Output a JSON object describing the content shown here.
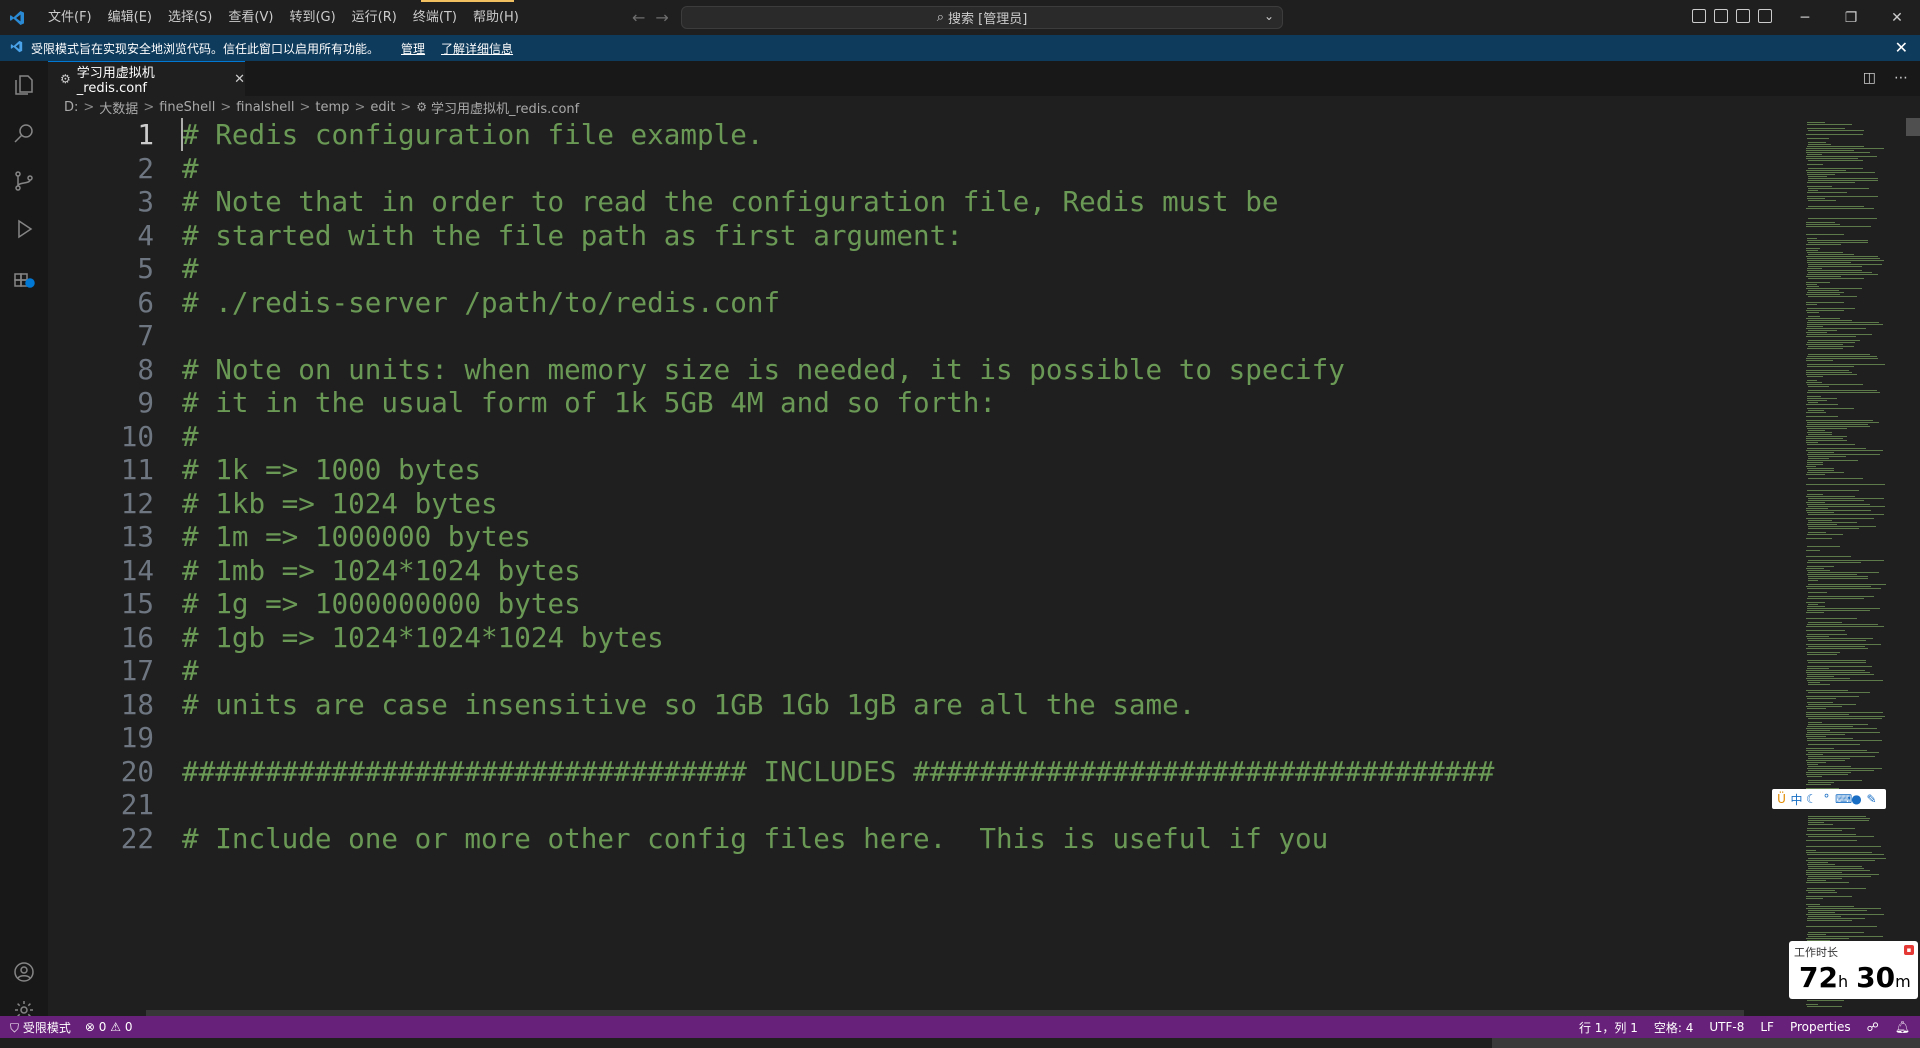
{
  "titlebar": {
    "menu": [
      "文件(F)",
      "编辑(E)",
      "选择(S)",
      "查看(V)",
      "转到(G)",
      "运行(R)",
      "终端(T)",
      "帮助(H)"
    ],
    "search_text": "搜索 [管理员]"
  },
  "banner": {
    "message": "受限模式旨在实现安全地浏览代码。信任此窗口以启用所有功能。",
    "manage_link": "管理",
    "learn_more_link": "了解详细信息"
  },
  "tab": {
    "filename": "学习用虚拟机_redis.conf"
  },
  "breadcrumb": [
    "D:",
    "大数据",
    "fineShell",
    "finalshell",
    "temp",
    "edit",
    "学习用虚拟机_redis.conf"
  ],
  "editor": {
    "active_line": 1,
    "lines": [
      {
        "num": "1",
        "text": "# Redis configuration file example."
      },
      {
        "num": "2",
        "text": "#"
      },
      {
        "num": "3",
        "text": "# Note that in order to read the configuration file, Redis must be"
      },
      {
        "num": "4",
        "text": "# started with the file path as first argument:"
      },
      {
        "num": "5",
        "text": "#"
      },
      {
        "num": "6",
        "text": "# ./redis-server /path/to/redis.conf"
      },
      {
        "num": "7",
        "text": ""
      },
      {
        "num": "8",
        "text": "# Note on units: when memory size is needed, it is possible to specify"
      },
      {
        "num": "9",
        "text": "# it in the usual form of 1k 5GB 4M and so forth:"
      },
      {
        "num": "10",
        "text": "#"
      },
      {
        "num": "11",
        "text": "# 1k => 1000 bytes"
      },
      {
        "num": "12",
        "text": "# 1kb => 1024 bytes"
      },
      {
        "num": "13",
        "text": "# 1m => 1000000 bytes"
      },
      {
        "num": "14",
        "text": "# 1mb => 1024*1024 bytes"
      },
      {
        "num": "15",
        "text": "# 1g => 1000000000 bytes"
      },
      {
        "num": "16",
        "text": "# 1gb => 1024*1024*1024 bytes"
      },
      {
        "num": "17",
        "text": "#"
      },
      {
        "num": "18",
        "text": "# units are case insensitive so 1GB 1Gb 1gB are all the same."
      },
      {
        "num": "19",
        "text": ""
      },
      {
        "num": "20",
        "text": "################################## INCLUDES ###################################"
      },
      {
        "num": "21",
        "text": ""
      },
      {
        "num": "22",
        "text": "# Include one or more other config files here.  This is useful if you"
      }
    ]
  },
  "worktime": {
    "label": "工作时长",
    "hours": "72",
    "hours_unit": "h",
    "minutes": "30",
    "minutes_unit": "m"
  },
  "statusbar": {
    "restricted_mode": "受限模式",
    "errors": "0",
    "warnings": "0",
    "position": "行 1，列 1",
    "spaces": "空格: 4",
    "encoding": "UTF-8",
    "eol": "LF",
    "language": "Properties"
  },
  "colors": {
    "comment": "#6a9955",
    "statusbar": "#68217a",
    "banner": "#0e3a5b",
    "editor_bg": "#1f1f1f"
  }
}
